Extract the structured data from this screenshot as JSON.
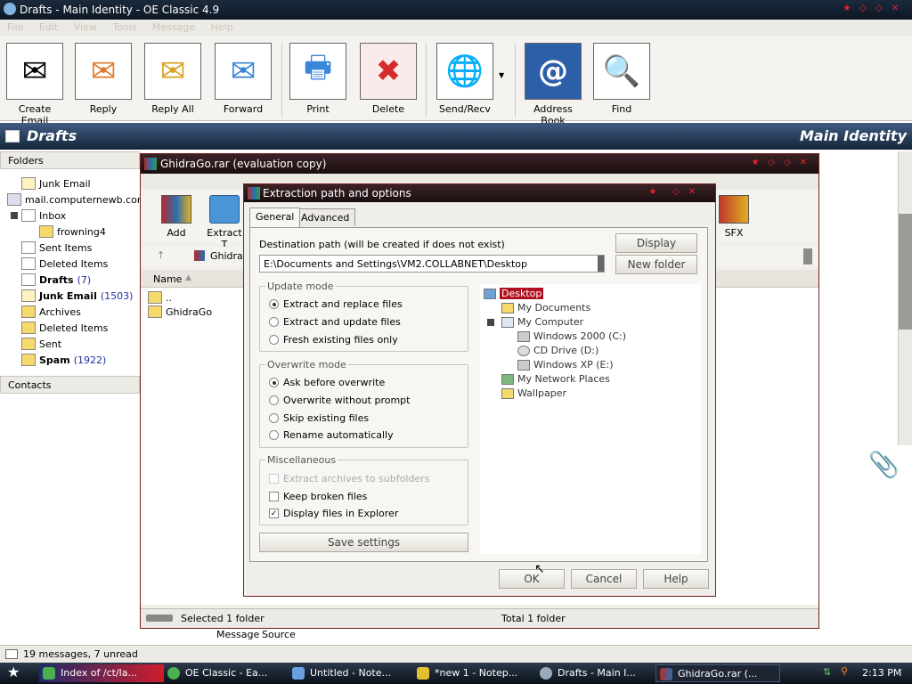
{
  "main": {
    "title": "Drafts - Main Identity - OE Classic 4.9",
    "menu": [
      "File",
      "Edit",
      "View",
      "Tools",
      "Message",
      "Help"
    ],
    "toolbar": [
      {
        "label": "Create Email",
        "icon": "create-email-icon",
        "glyph": "✉"
      },
      {
        "label": "Reply",
        "icon": "reply-icon",
        "glyph": "✉"
      },
      {
        "label": "Reply All",
        "icon": "reply-all-icon",
        "glyph": "✉"
      },
      {
        "label": "Forward",
        "icon": "forward-icon",
        "glyph": "✉"
      },
      {
        "label": "Print",
        "icon": "print-icon",
        "glyph": "🖶"
      },
      {
        "label": "Delete",
        "icon": "delete-icon",
        "glyph": "✖"
      },
      {
        "label": "Send/Recv",
        "icon": "send-recv-icon",
        "glyph": "🌐"
      },
      {
        "label": "Address Book",
        "icon": "address-book-icon",
        "glyph": "@"
      },
      {
        "label": "Find",
        "icon": "find-icon",
        "glyph": "🔍"
      }
    ],
    "banner_left": "Drafts",
    "banner_right": "Main Identity",
    "folders_header": "Folders",
    "contacts_header": "Contacts",
    "folders": {
      "junk_email": "Junk Email",
      "account": "mail.computernewb.com",
      "inbox": "Inbox",
      "frowning": "frowning4",
      "sent_items": "Sent Items",
      "deleted_items": "Deleted Items",
      "drafts": "Drafts",
      "drafts_count": "(7)",
      "junk_email2": "Junk Email",
      "junk_count": "(1503)",
      "archives": "Archives",
      "deleted_items2": "Deleted Items",
      "sent": "Sent",
      "spam": "Spam",
      "spam_count": "(1922)"
    },
    "status": "19 messages, 7 unread",
    "preview_tabs": [
      "Message",
      "Source"
    ]
  },
  "rar": {
    "title": "GhidraGo.rar (evaluation copy)",
    "toolbar": [
      "Add",
      "Extract T",
      "SFX"
    ],
    "path": "GhidraG",
    "column_name": "Name",
    "files": [
      "..",
      "GhidraGo"
    ],
    "status_left": "Selected 1 folder",
    "status_right": "Total 1 folder"
  },
  "dialog": {
    "title": "Extraction path and options",
    "tabs": [
      "General",
      "Advanced"
    ],
    "dest_label": "Destination path (will be created if does not exist)",
    "dest_value": "E:\\Documents and Settings\\VM2.COLLABNET\\Desktop",
    "display_btn": "Display",
    "newfolder_btn": "New folder",
    "update_mode": {
      "title": "Update mode",
      "options": [
        "Extract and replace files",
        "Extract and update files",
        "Fresh existing files only"
      ],
      "selected": 0
    },
    "overwrite_mode": {
      "title": "Overwrite mode",
      "options": [
        "Ask before overwrite",
        "Overwrite without prompt",
        "Skip existing files",
        "Rename automatically"
      ],
      "selected": 0
    },
    "misc": {
      "title": "Miscellaneous",
      "extract_subfolders": "Extract archives to subfolders",
      "keep_broken": "Keep broken files",
      "display_explorer": "Display files in Explorer"
    },
    "save_settings": "Save settings",
    "tree": [
      "Desktop",
      "My Documents",
      "My Computer",
      "Windows 2000 (C:)",
      "CD Drive (D:)",
      "Windows XP (E:)",
      "My Network Places",
      "Wallpaper"
    ],
    "ok": "OK",
    "cancel": "Cancel",
    "help": "Help"
  },
  "taskbar": {
    "items": [
      "Index of /ct/la...",
      "OE Classic - Ea...",
      "Untitled - Note...",
      "*new 1 - Notep...",
      "Drafts - Main I...",
      "GhidraGo.rar (..."
    ],
    "time": "2:13 PM"
  },
  "colors": {
    "accent": "#c8102e",
    "banner": "#2a4466",
    "selection": "#b01020"
  }
}
